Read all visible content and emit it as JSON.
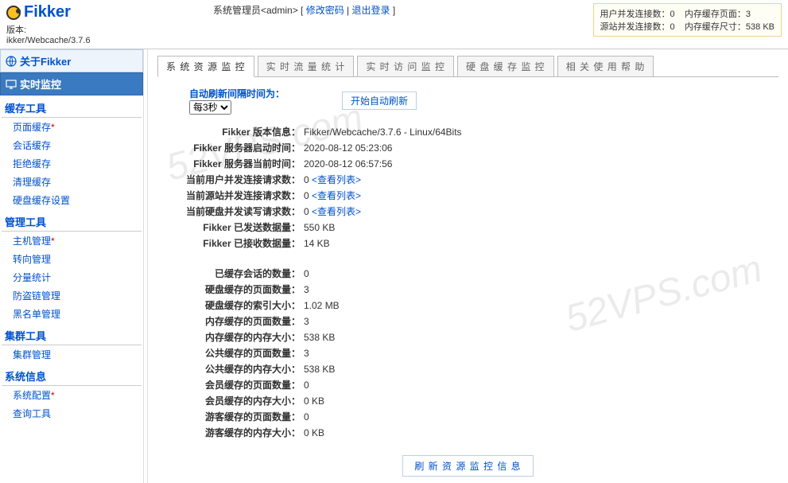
{
  "brand": "Fikker",
  "version_label": "版本:",
  "version_value": "ikker/Webcache/3.7.6",
  "admin": {
    "prefix": "系统管理员<admin> [ ",
    "change_pw": "修改密码",
    "sep": " | ",
    "logout": "退出登录",
    "suffix": " ]"
  },
  "status": {
    "r1a_label": "用户并发连接数：",
    "r1a_val": "0",
    "r1b_label": "内存缓存页面：",
    "r1b_val": "3",
    "r2a_label": "源站并发连接数：",
    "r2a_val": "0",
    "r2b_label": "内存缓存尺寸：",
    "r2b_val": "538 KB"
  },
  "sidebar": {
    "about": "关于Fikker",
    "realtime": "实时监控",
    "groups": [
      {
        "title": "缓存工具",
        "items": [
          {
            "label": "页面缓存",
            "star": true
          },
          {
            "label": "会话缓存",
            "star": false
          },
          {
            "label": "拒绝缓存",
            "star": false
          },
          {
            "label": "清理缓存",
            "star": false
          },
          {
            "label": "硬盘缓存设置",
            "star": false
          }
        ]
      },
      {
        "title": "管理工具",
        "items": [
          {
            "label": "主机管理",
            "star": true
          },
          {
            "label": "转向管理",
            "star": false
          },
          {
            "label": "分量统计",
            "star": false
          },
          {
            "label": "防盗链管理",
            "star": false
          },
          {
            "label": "黑名单管理",
            "star": false
          }
        ]
      },
      {
        "title": "集群工具",
        "items": [
          {
            "label": "集群管理",
            "star": false
          }
        ]
      },
      {
        "title": "系统信息",
        "items": [
          {
            "label": "系统配置",
            "star": true
          },
          {
            "label": "查询工具",
            "star": false
          }
        ]
      }
    ]
  },
  "tabs": [
    "系 统 资 源 监 控",
    "实 时 流 量 统 计",
    "实 时 访 问 监 控",
    "硬 盘 缓 存 监 控",
    "相 关 使 用 帮 助"
  ],
  "refresh": {
    "label": "自动刷新间隔时间为：",
    "selected": "每3秒",
    "start_btn": "开始自动刷新"
  },
  "info1": [
    {
      "label": "Fikker 版本信息：",
      "value": "Fikker/Webcache/3.7.6 - Linux/64Bits"
    },
    {
      "label": "Fikker 服务器启动时间：",
      "value": "2020-08-12 05:23:06"
    },
    {
      "label": "Fikker 服务器当前时间：",
      "value": "2020-08-12 06:57:56"
    },
    {
      "label": "当前用户并发连接请求数：",
      "value": "0",
      "link": "<查看列表>"
    },
    {
      "label": "当前源站并发连接请求数：",
      "value": "0",
      "link": "<查看列表>"
    },
    {
      "label": "当前硬盘并发读写请求数：",
      "value": "0",
      "link": "<查看列表>"
    },
    {
      "label": "Fikker 已发送数据量：",
      "value": "550 KB"
    },
    {
      "label": "Fikker 已接收数据量：",
      "value": "14 KB"
    }
  ],
  "info2": [
    {
      "label": "已缓存会话的数量：",
      "value": "0"
    },
    {
      "label": "硬盘缓存的页面数量：",
      "value": "3"
    },
    {
      "label": "硬盘缓存的索引大小：",
      "value": "1.02 MB"
    },
    {
      "label": "内存缓存的页面数量：",
      "value": "3"
    },
    {
      "label": "内存缓存的内存大小：",
      "value": "538 KB"
    },
    {
      "label": "公共缓存的页面数量：",
      "value": "3"
    },
    {
      "label": "公共缓存的内存大小：",
      "value": "538 KB"
    },
    {
      "label": "会员缓存的页面数量：",
      "value": "0"
    },
    {
      "label": "会员缓存的内存大小：",
      "value": "0 KB"
    },
    {
      "label": "游客缓存的页面数量：",
      "value": "0"
    },
    {
      "label": "游客缓存的内存大小：",
      "value": "0 KB"
    }
  ],
  "bottom_btn": "刷 新 资 源 监 控 信 息",
  "watermark": "52VPS.com"
}
